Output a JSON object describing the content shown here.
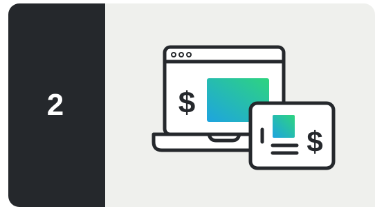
{
  "step": {
    "number": "2"
  },
  "illustration": {
    "laptop_currency_symbol": "$",
    "card_currency_symbol": "$",
    "icon": "laptop-and-payment-card-icon"
  },
  "colors": {
    "step_panel": "#25282c",
    "illustration_panel": "#eff0ed",
    "outline": "#25282c",
    "gradient_start": "#2ed47f",
    "gradient_end": "#1ea4e0"
  }
}
